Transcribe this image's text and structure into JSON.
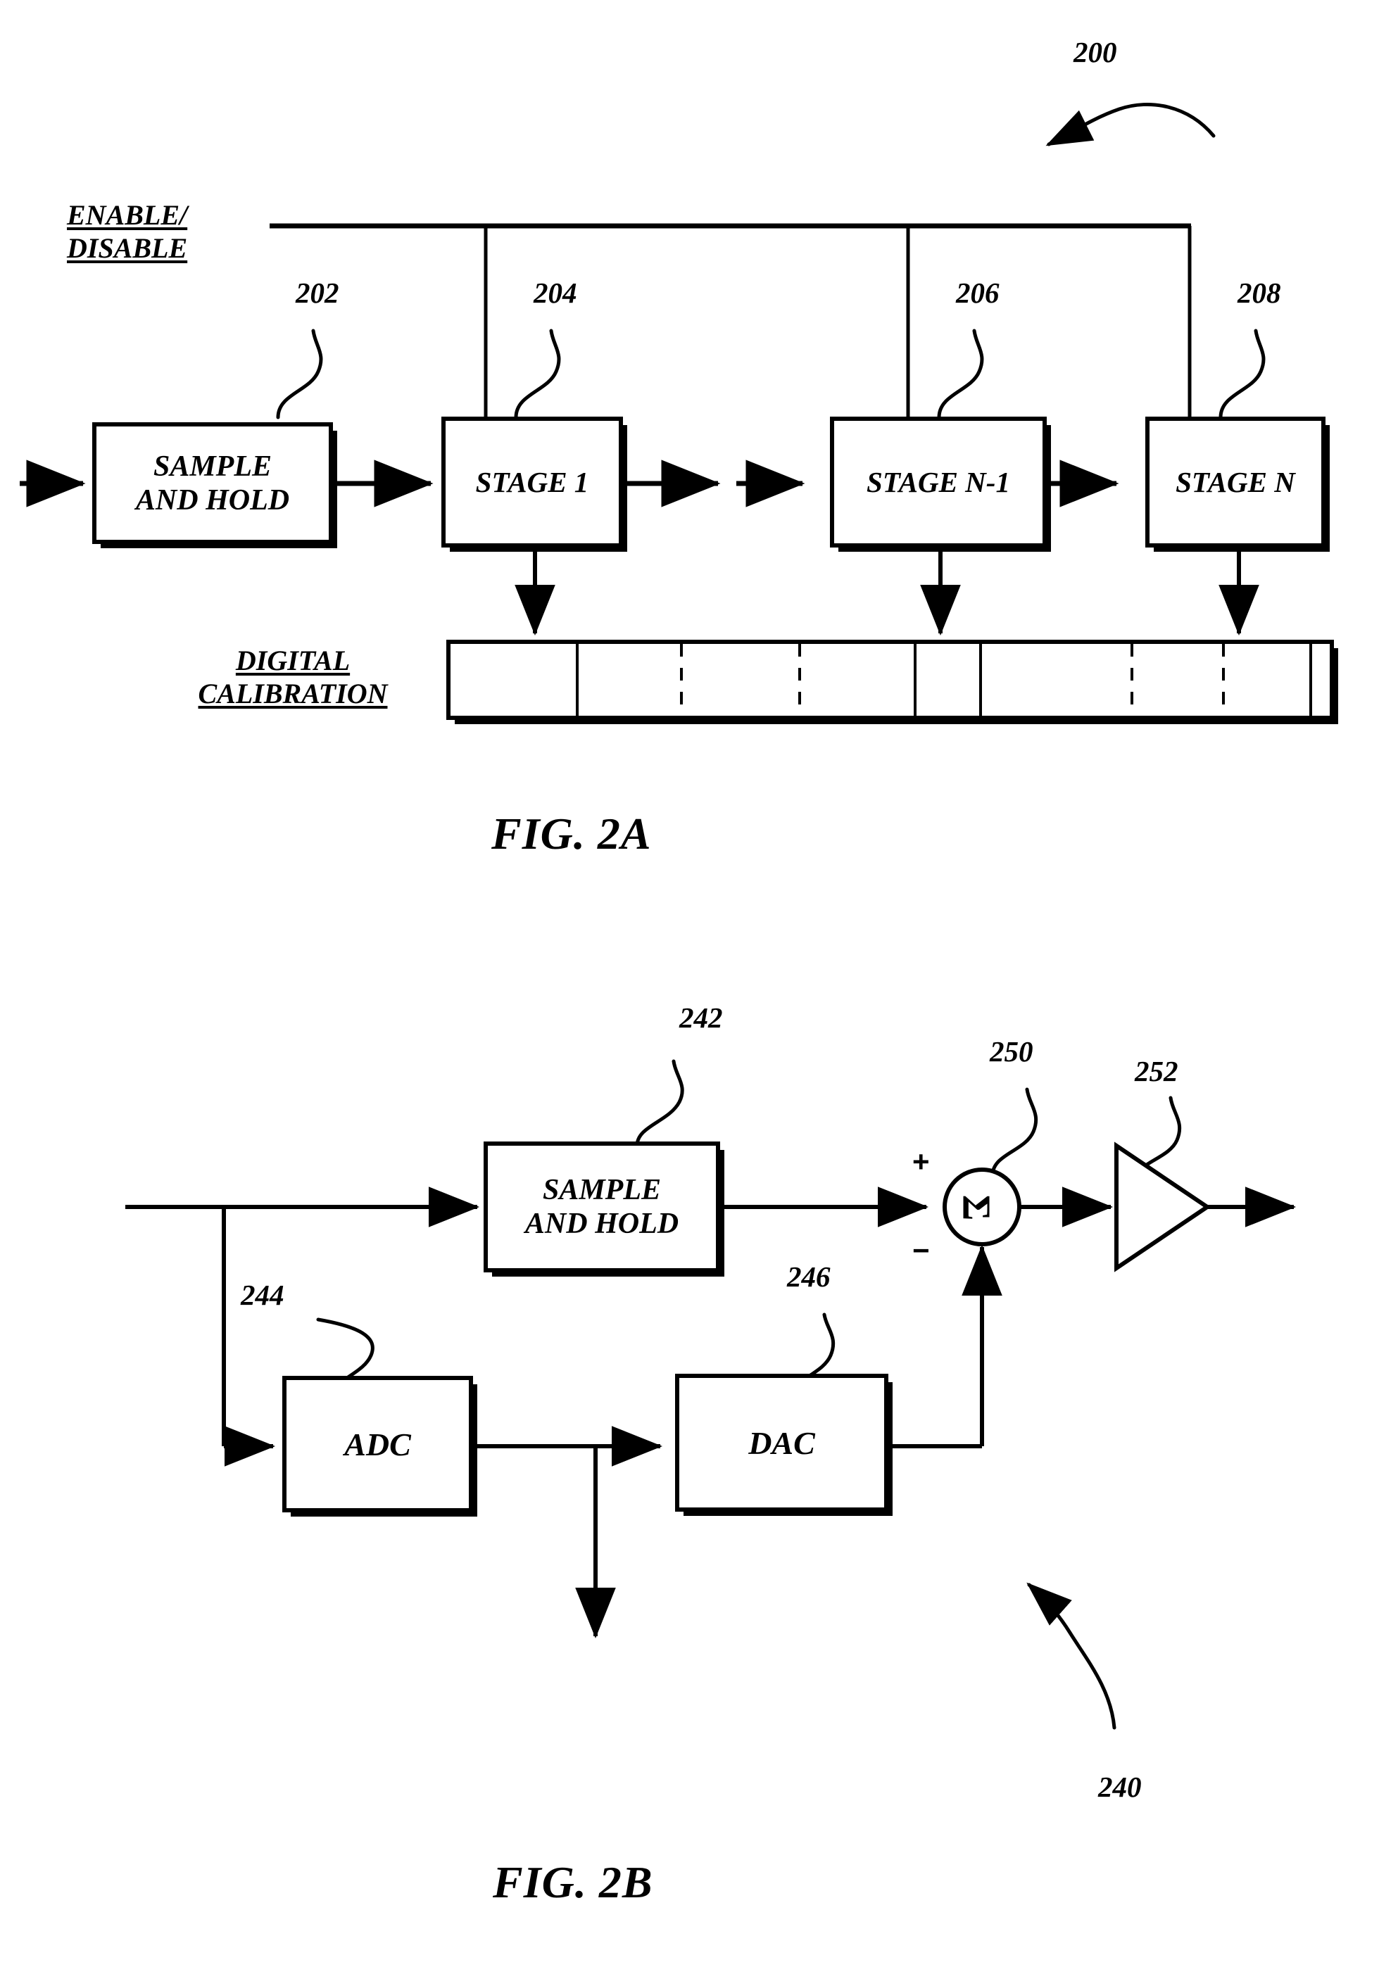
{
  "document": {
    "kind": "patent-drawing-sheet",
    "figures": [
      "FIG. 2A",
      "FIG. 2B"
    ]
  },
  "fig2a": {
    "caption": "FIG. 2A",
    "assembly_ref": "200",
    "control_label_line1": "ENABLE/",
    "control_label_line2": "DISABLE",
    "calibration_label_line1": "DIGITAL",
    "calibration_label_line2": "CALIBRATION",
    "blocks": [
      {
        "id": "sample-and-hold",
        "ref": "202",
        "line1": "SAMPLE",
        "line2": "AND HOLD"
      },
      {
        "id": "stage-1",
        "ref": "204",
        "line1": "STAGE 1",
        "line2": ""
      },
      {
        "id": "stage-n-minus-1",
        "ref": "206",
        "line1": "STAGE N-1",
        "line2": ""
      },
      {
        "id": "stage-n",
        "ref": "208",
        "line1": "STAGE N",
        "line2": ""
      }
    ],
    "calibration_bar": {
      "cells": 9,
      "divider_styles": [
        "solid",
        "dashed",
        "dashed",
        "solid",
        "solid",
        "dashed",
        "dashed",
        "solid"
      ]
    }
  },
  "fig2b": {
    "caption": "FIG. 2B",
    "assembly_ref": "240",
    "blocks": [
      {
        "id": "sample-and-hold",
        "ref": "242",
        "line1": "SAMPLE",
        "line2": "AND HOLD"
      },
      {
        "id": "adc",
        "ref": "244",
        "line1": "ADC",
        "line2": ""
      },
      {
        "id": "dac",
        "ref": "246",
        "line1": "DAC",
        "line2": ""
      }
    ],
    "summer": {
      "id": "summing-node",
      "ref": "250",
      "symbol": "Σ",
      "plus": "+",
      "minus": "−"
    },
    "amplifier": {
      "id": "gain-amplifier",
      "ref": "252"
    }
  },
  "colors": {
    "ink": "#000000",
    "paper": "#ffffff"
  }
}
